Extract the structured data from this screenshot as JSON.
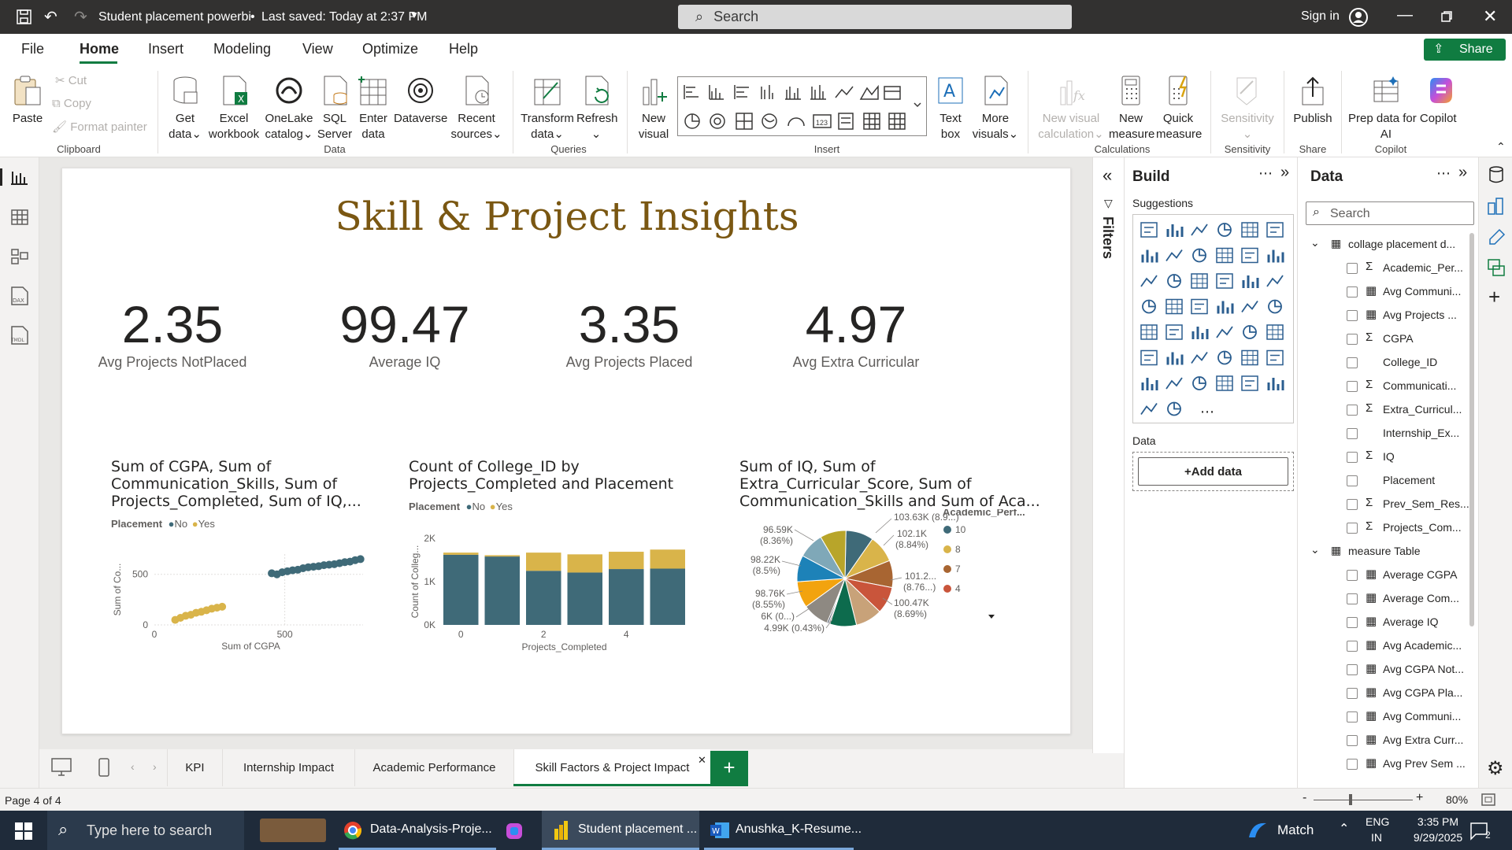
{
  "titlebar": {
    "file_title": "Student placement powerbi",
    "saved": "Last saved: Today at 2:37 PM",
    "search_placeholder": "Search",
    "sign_in": "Sign in"
  },
  "menu": {
    "items": [
      "File",
      "Home",
      "Insert",
      "Modeling",
      "View",
      "Optimize",
      "Help"
    ],
    "active": "Home",
    "share": "Share"
  },
  "ribbon": {
    "clipboard": {
      "paste": "Paste",
      "cut": "Cut",
      "copy": "Copy",
      "format_painter": "Format painter",
      "group": "Clipboard"
    },
    "data": {
      "get_data_1": "Get",
      "get_data_2": "data",
      "excel_1": "Excel",
      "excel_2": "workbook",
      "onelake_1": "OneLake",
      "onelake_2": "catalog",
      "sql_1": "SQL",
      "sql_2": "Server",
      "enter_1": "Enter",
      "enter_2": "data",
      "dataverse": "Dataverse",
      "recent_1": "Recent",
      "recent_2": "sources",
      "group": "Data"
    },
    "queries": {
      "transform_1": "Transform",
      "transform_2": "data",
      "refresh": "Refresh",
      "group": "Queries"
    },
    "insert": {
      "new_visual_1": "New",
      "new_visual_2": "visual",
      "text_box_1": "Text",
      "text_box_2": "box",
      "more_visuals_1": "More",
      "more_visuals_2": "visuals",
      "group": "Insert"
    },
    "calculations": {
      "new_visual_calc_1": "New visual",
      "new_visual_calc_2": "calculation",
      "new_measure_1": "New",
      "new_measure_2": "measure",
      "quick_measure_1": "Quick",
      "quick_measure_2": "measure",
      "group": "Calculations"
    },
    "sensitivity": {
      "label": "Sensitivity",
      "group": "Sensitivity"
    },
    "share": {
      "publish": "Publish",
      "group": "Share"
    },
    "copilot": {
      "prep_1": "Prep data for Copilot",
      "prep_2": "AI",
      "copilot": "Copilot",
      "group": "Copilot"
    }
  },
  "report": {
    "title": "Skill & Project Insights",
    "kpis": [
      {
        "value": "2.35",
        "label": "Avg Projects NotPlaced"
      },
      {
        "value": "99.47",
        "label": "Average IQ"
      },
      {
        "value": "3.35",
        "label": "Avg Projects Placed"
      },
      {
        "value": "4.97",
        "label": "Avg Extra Curricular"
      }
    ],
    "scatter": {
      "title_lines": [
        "Sum of CGPA, Sum of",
        "Communication_Skills, Sum of",
        "Projects_Completed, Sum of IQ,..."
      ],
      "legend_title": "Placement",
      "legend_no": "No",
      "legend_yes": "Yes",
      "y_label": "Sum of Co...",
      "x_label": "Sum of CGPA",
      "y_tick_top": "500",
      "y_tick_bottom": "0",
      "x_tick_left": "0",
      "x_tick_right": "500"
    },
    "bar": {
      "title_lines": [
        "Count of College_ID by",
        "Projects_Completed and Placement"
      ],
      "legend_title": "Placement",
      "legend_no": "No",
      "legend_yes": "Yes",
      "y_label": "Count of Colleg...",
      "x_label": "Projects_Completed",
      "y_ticks": [
        "2K",
        "1K",
        "0K"
      ],
      "x_ticks": [
        "0",
        "2",
        "4"
      ]
    },
    "pie": {
      "title_lines": [
        "Sum of IQ, Sum of",
        "Extra_Curricular_Score, Sum of",
        "Communication_Skills and Sum of Aca..."
      ],
      "legend_title": "Academic_Perf...",
      "legend_items": [
        "10",
        "8",
        "7",
        "4"
      ],
      "labels": {
        "l1a": "96.59K",
        "l1b": "(8.36%)",
        "l2a": "98.22K",
        "l2b": "(8.5%)",
        "l3a": "98.76K",
        "l3b": "(8.55%)",
        "l4": "6K (0...)",
        "l5": "4.99K (0.43%)",
        "r1": "103.63K (8.9...)",
        "r2a": "102.1K",
        "r2b": "(8.84%)",
        "r3a": "101.2...",
        "r3b": "(8.76...)",
        "r4a": "100.47K",
        "r4b": "(8.69%)"
      }
    }
  },
  "colors": {
    "no": "#3f6a78",
    "yes": "#d9b44a",
    "accent": "#107c41",
    "title": "#7a5712"
  },
  "chart_data": [
    {
      "type": "scatter",
      "title": "Sum of CGPA, Sum of Communication_Skills, Sum of Projects_Completed, Sum of IQ,...",
      "xlabel": "Sum of CGPA",
      "ylabel": "Sum of Co...",
      "series": [
        {
          "name": "No",
          "points": [
            [
              450,
              510
            ],
            [
              470,
              500
            ],
            [
              490,
              520
            ],
            [
              510,
              530
            ],
            [
              530,
              540
            ],
            [
              550,
              545
            ],
            [
              570,
              560
            ],
            [
              590,
              570
            ],
            [
              610,
              575
            ],
            [
              630,
              580
            ],
            [
              650,
              590
            ],
            [
              670,
              595
            ],
            [
              690,
              600
            ],
            [
              710,
              610
            ],
            [
              730,
              620
            ],
            [
              750,
              625
            ],
            [
              770,
              640
            ],
            [
              790,
              650
            ]
          ]
        },
        {
          "name": "Yes",
          "points": [
            [
              80,
              50
            ],
            [
              100,
              70
            ],
            [
              120,
              90
            ],
            [
              140,
              100
            ],
            [
              160,
              120
            ],
            [
              180,
              130
            ],
            [
              200,
              145
            ],
            [
              220,
              160
            ],
            [
              240,
              170
            ],
            [
              260,
              180
            ]
          ]
        }
      ]
    },
    {
      "type": "bar",
      "title": "Count of College_ID by Projects_Completed and Placement",
      "xlabel": "Projects_Completed",
      "ylabel": "Count of Colleg...",
      "categories": [
        "0",
        "1",
        "2",
        "3",
        "4",
        "5"
      ],
      "series": [
        {
          "name": "No",
          "values": [
            1620,
            1580,
            1250,
            1210,
            1290,
            1300
          ]
        },
        {
          "name": "Yes",
          "values": [
            50,
            30,
            420,
            420,
            400,
            440
          ]
        }
      ],
      "ylim": [
        0,
        2000
      ]
    },
    {
      "type": "pie",
      "title": "Sum of IQ, Sum of Extra_Curricular_Score, Sum of Communication_Skills and Sum of Aca...",
      "legend_title": "Academic_Perf...",
      "slices": [
        {
          "label": "103.63K (8.9...)",
          "value": 103630,
          "color": "#3f6a78"
        },
        {
          "label": "102.1K (8.84%)",
          "value": 102100,
          "color": "#d9b44a"
        },
        {
          "label": "101.2... (8.76...)",
          "value": 101200,
          "color": "#a86532"
        },
        {
          "label": "100.47K (8.69%)",
          "value": 100470,
          "color": "#c9553b"
        },
        {
          "label": "",
          "value": 99500,
          "color": "#c8a279"
        },
        {
          "label": "",
          "value": 99200,
          "color": "#0d6b4d"
        },
        {
          "label": "4.99K (0.43%)",
          "value": 4990,
          "color": "#6b6b6b"
        },
        {
          "label": "6K (0...)",
          "value": 6000,
          "color": "#303b4e"
        },
        {
          "label": "98.76K (8.55%)",
          "value": 98760,
          "color": "#8e8982"
        },
        {
          "label": "98.22K (8.5%)",
          "value": 98220,
          "color": "#f2a30f"
        },
        {
          "label": "",
          "value": 98500,
          "color": "#1d82b8"
        },
        {
          "label": "96.59K (8.36%)",
          "value": 96590,
          "color": "#7fa8b8"
        },
        {
          "label": "",
          "value": 97000,
          "color": "#b8a52a"
        }
      ]
    }
  ],
  "build": {
    "title": "Build",
    "suggestions": "Suggestions",
    "data_label": "Data",
    "add_data": "+Add data",
    "filters": "Filters"
  },
  "datapane": {
    "title": "Data",
    "search_placeholder": "Search",
    "table1": "collage placement d...",
    "fields1": [
      {
        "name": "Academic_Per...",
        "sigma": true
      },
      {
        "name": "Avg Communi...",
        "calc": true
      },
      {
        "name": "Avg Projects ...",
        "calc": true
      },
      {
        "name": "CGPA",
        "sigma": true
      },
      {
        "name": "College_ID"
      },
      {
        "name": "Communicati...",
        "sigma": true
      },
      {
        "name": "Extra_Curricul...",
        "sigma": true
      },
      {
        "name": "Internship_Ex..."
      },
      {
        "name": "IQ",
        "sigma": true
      },
      {
        "name": "Placement"
      },
      {
        "name": "Prev_Sem_Res...",
        "sigma": true
      },
      {
        "name": "Projects_Com...",
        "sigma": true
      }
    ],
    "table2": "measure Table",
    "fields2": [
      {
        "name": "Average CGPA",
        "calc": true
      },
      {
        "name": "Average Com...",
        "calc": true
      },
      {
        "name": "Average IQ",
        "calc": true
      },
      {
        "name": "Avg Academic...",
        "calc": true
      },
      {
        "name": "Avg CGPA Not...",
        "calc": true
      },
      {
        "name": "Avg CGPA Pla...",
        "calc": true
      },
      {
        "name": "Avg Communi...",
        "calc": true
      },
      {
        "name": "Avg Extra Curr...",
        "calc": true
      },
      {
        "name": "Avg Prev Sem ...",
        "calc": true
      }
    ]
  },
  "tabs": [
    "KPI",
    "Internship Impact",
    "Academic Performance",
    "Skill Factors & Project Impact"
  ],
  "active_tab": "Skill Factors & Project Impact",
  "status": {
    "page": "Page 4 of 4",
    "zoom": "80%"
  },
  "taskbar": {
    "search": "Type here to search",
    "app1": "Data-Analysis-Proje...",
    "app2": "Student placement ...",
    "app3": "Anushka_K-Resume...",
    "weather": "Match",
    "lang1": "ENG",
    "lang2": "IN",
    "time": "3:35 PM",
    "date": "9/29/2025",
    "notif": "2"
  }
}
